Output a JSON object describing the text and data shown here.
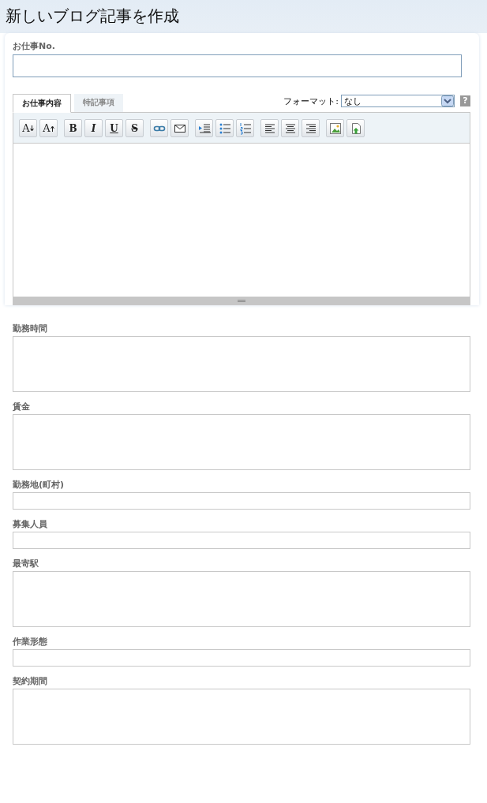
{
  "page_title": "新しいブログ記事を作成",
  "job_no": {
    "label": "お仕事No."
  },
  "editor": {
    "tabs": [
      {
        "label": "お仕事内容",
        "selected": true
      },
      {
        "label": "特記事項",
        "selected": false
      }
    ],
    "format": {
      "label": "フォーマット:",
      "value": "なし"
    },
    "help": "?",
    "toolbar": [
      [
        {
          "kind": "smaller",
          "glyph": "A"
        },
        {
          "kind": "larger",
          "glyph": "A"
        }
      ],
      [
        {
          "kind": "bold",
          "glyph": "B"
        },
        {
          "kind": "italic",
          "glyph": "I"
        },
        {
          "kind": "underline",
          "glyph": "U"
        },
        {
          "kind": "strike",
          "glyph": "S"
        }
      ],
      [
        {
          "kind": "link"
        },
        {
          "kind": "email"
        }
      ],
      [
        {
          "kind": "indent"
        },
        {
          "kind": "bullets"
        },
        {
          "kind": "numbers"
        }
      ],
      [
        {
          "kind": "left"
        },
        {
          "kind": "center"
        },
        {
          "kind": "right"
        }
      ],
      [
        {
          "kind": "image"
        },
        {
          "kind": "upload"
        }
      ]
    ]
  },
  "fields": [
    {
      "label": "勤務時間",
      "kind": "textarea"
    },
    {
      "label": "賃金",
      "kind": "textarea"
    },
    {
      "label": "勤務地(町村)",
      "kind": "input"
    },
    {
      "label": "募集人員",
      "kind": "input"
    },
    {
      "label": "最寄駅",
      "kind": "textarea"
    },
    {
      "label": "作業形態",
      "kind": "input"
    },
    {
      "label": "契約期間",
      "kind": "textarea"
    }
  ]
}
